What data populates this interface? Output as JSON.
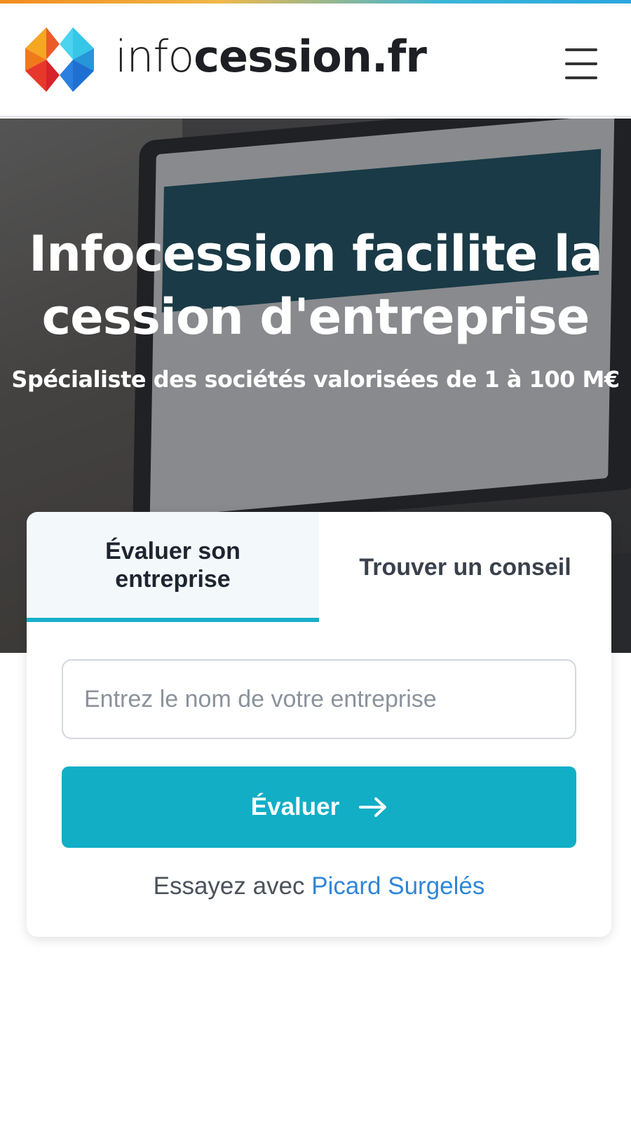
{
  "header": {
    "brand_light": "info",
    "brand_bold": "cession.fr",
    "menu_icon": "hamburger-menu-icon",
    "logo_icon": "infocession-logo-icon"
  },
  "colors": {
    "accent": "#11aec6",
    "link": "#2f86d8",
    "tab_active_bg": "#f3f8fb",
    "text_dark": "#1d2530"
  },
  "hero": {
    "title": "Infocession facilite la cession d'entreprise",
    "subtitle": "Spécialiste des sociétés valorisées de 1 à 100 M€"
  },
  "card": {
    "tabs": [
      {
        "label": "Évaluer son entreprise",
        "active": true
      },
      {
        "label": "Trouver un conseil",
        "active": false
      }
    ],
    "search_placeholder": "Entrez le nom de votre entreprise",
    "search_value": "",
    "submit_label": "Évaluer",
    "submit_icon": "arrow-right-icon",
    "try_prefix": "Essayez avec",
    "try_example": "Picard Surgelés"
  }
}
